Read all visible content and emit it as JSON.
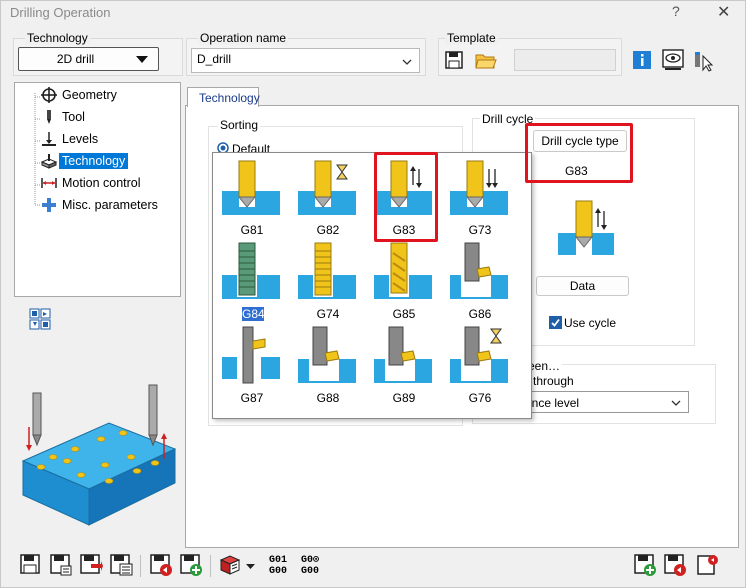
{
  "window": {
    "title": "Drilling Operation",
    "help": "?",
    "close": "✕"
  },
  "technology": {
    "label": "Technology",
    "value": "2D drill"
  },
  "operation_name": {
    "label": "Operation name",
    "value": "D_drill"
  },
  "template": {
    "label": "Template"
  },
  "tree": [
    {
      "label": "Geometry"
    },
    {
      "label": "Tool"
    },
    {
      "label": "Levels"
    },
    {
      "label": "Technology"
    },
    {
      "label": "Motion control"
    },
    {
      "label": "Misc. parameters"
    }
  ],
  "tab_label": "Technology",
  "sorting": {
    "label": "Sorting",
    "default_label": "Default"
  },
  "drill_cycle": {
    "label": "Drill cycle",
    "type_button": "Drill cycle type",
    "type_value": "G83",
    "data_button": "Data",
    "use_cycle": "Use cycle"
  },
  "between": {
    "label": "een…",
    "through": "through",
    "select": "ance level"
  },
  "cycles": [
    {
      "code": "G81"
    },
    {
      "code": "G82"
    },
    {
      "code": "G83"
    },
    {
      "code": "G73"
    },
    {
      "code": "G84"
    },
    {
      "code": "G74"
    },
    {
      "code": "G85"
    },
    {
      "code": "G86"
    },
    {
      "code": "G87"
    },
    {
      "code": "G88"
    },
    {
      "code": "G89"
    },
    {
      "code": "G76"
    }
  ],
  "toolbar": {
    "g01": "G01",
    "g00": "G00",
    "g0c": "G0⊙",
    "g00b": "G00"
  },
  "colors": {
    "accent": "#0078d7",
    "highlight": "#e0141e",
    "water": "#29a8e0",
    "drill": "#f1c40f"
  }
}
